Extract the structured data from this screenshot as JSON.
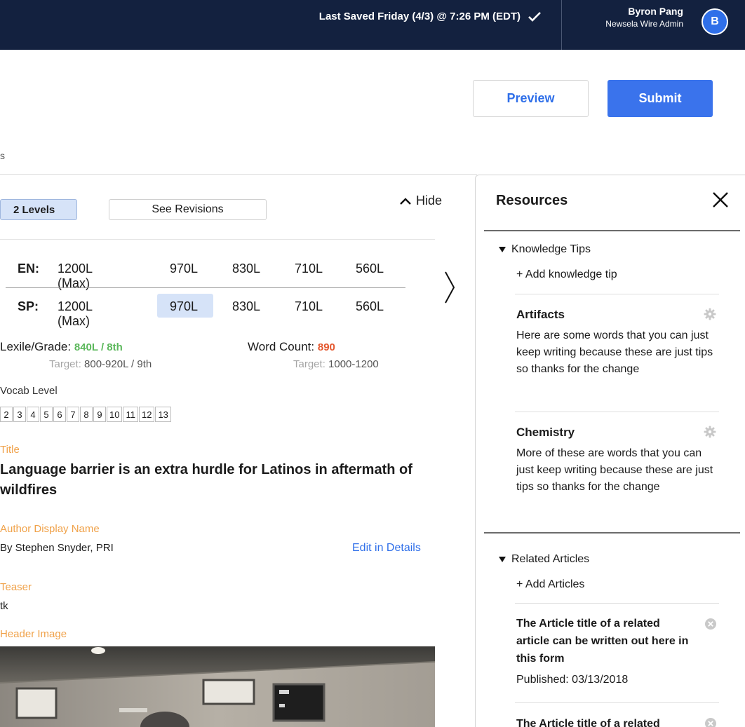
{
  "topbar": {
    "last_saved": "Last Saved Friday (4/3) @ 7:26 PM (EDT)",
    "user_name": "Byron Pang",
    "user_role": "Newsela Wire Admin",
    "avatar_initial": "B"
  },
  "actions": {
    "preview": "Preview",
    "submit": "Submit"
  },
  "crumb_fragment": "s",
  "editor": {
    "levels_label": "2 Levels",
    "see_revisions": "See Revisions",
    "hide": "Hide",
    "rows": [
      {
        "lang": "EN:",
        "levels": [
          "1200L (Max)",
          "970L",
          "830L",
          "710L",
          "560L"
        ]
      },
      {
        "lang": "SP:",
        "levels": [
          "1200L (Max)",
          "970L",
          "830L",
          "710L",
          "560L"
        ],
        "selected_index": 1
      }
    ],
    "lexile_label": "Lexile/Grade:",
    "lexile_value": "840L / 8th",
    "lexile_target_label": "Target:",
    "lexile_target": "800-920L / 9th",
    "word_count_label": "Word Count:",
    "word_count_value": "890",
    "word_count_target_label": "Target:",
    "word_count_target": "1000-1200",
    "vocab_label": "Vocab Level",
    "vocab_levels": [
      "2",
      "3",
      "4",
      "5",
      "6",
      "7",
      "8",
      "9",
      "10",
      "11",
      "12",
      "13"
    ],
    "title_label": "Title",
    "title": "Language barrier is an extra hurdle for Latinos in aftermath of wildfires",
    "author_label": "Author Display Name",
    "author": "By Stephen Snyder, PRI",
    "edit_details": "Edit in Details",
    "teaser_label": "Teaser",
    "teaser": "tk",
    "header_image_label": "Header Image"
  },
  "resources": {
    "title": "Resources",
    "knowledge_tips": {
      "heading": "Knowledge Tips",
      "add": "+ Add knowledge tip",
      "tips": [
        {
          "title": "Artifacts",
          "body": "Here are some words that you can just keep writing because these are just tips so thanks for the change"
        },
        {
          "title": "Chemistry",
          "body": "More of these are words that you can just keep writing because these are just tips so thanks for the change"
        }
      ]
    },
    "related_articles": {
      "heading": "Related Articles",
      "add": "+ Add Articles",
      "articles": [
        {
          "title": "The Article title of a related article can be written out here in this form",
          "date": "Published: 03/13/2018"
        },
        {
          "title": "The Article title of a related"
        }
      ]
    }
  },
  "colors": {
    "nav_bg": "#13213f",
    "accent_blue": "#3a73ec",
    "highlight": "#d6e3f8",
    "lexile_green": "#5cb85c",
    "word_count_red": "#e4572e",
    "label_orange": "#f0a24a"
  }
}
